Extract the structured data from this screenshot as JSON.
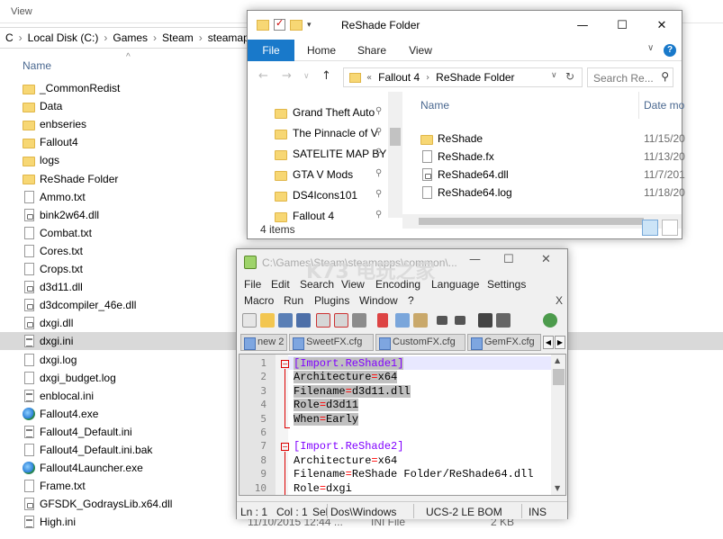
{
  "background_explorer": {
    "ribbon_tab": "View",
    "breadcrumb": [
      "C",
      "Local Disk (C:)",
      "Games",
      "Steam",
      "steamapps"
    ],
    "column_name": "Name",
    "rows": [
      {
        "name": "_CommonRedist",
        "type": "folder"
      },
      {
        "name": "Data",
        "type": "folder"
      },
      {
        "name": "enbseries",
        "type": "folder"
      },
      {
        "name": "Fallout4",
        "type": "folder"
      },
      {
        "name": "logs",
        "type": "folder"
      },
      {
        "name": "ReShade Folder",
        "type": "folder"
      },
      {
        "name": "Ammo.txt",
        "type": "file"
      },
      {
        "name": "bink2w64.dll",
        "type": "dll"
      },
      {
        "name": "Combat.txt",
        "type": "file"
      },
      {
        "name": "Cores.txt",
        "type": "file"
      },
      {
        "name": "Crops.txt",
        "type": "file"
      },
      {
        "name": "d3d11.dll",
        "type": "dll"
      },
      {
        "name": "d3dcompiler_46e.dll",
        "type": "dll"
      },
      {
        "name": "dxgi.dll",
        "type": "dll"
      },
      {
        "name": "dxgi.ini",
        "type": "ini",
        "selected": true
      },
      {
        "name": "dxgi.log",
        "type": "file"
      },
      {
        "name": "dxgi_budget.log",
        "type": "file"
      },
      {
        "name": "enblocal.ini",
        "type": "ini"
      },
      {
        "name": "Fallout4.exe",
        "type": "exe"
      },
      {
        "name": "Fallout4_Default.ini",
        "type": "ini"
      },
      {
        "name": "Fallout4_Default.ini.bak",
        "type": "file"
      },
      {
        "name": "Fallout4Launcher.exe",
        "type": "exe"
      },
      {
        "name": "Frame.txt",
        "type": "file"
      },
      {
        "name": "GFSDK_GodraysLib.x64.dll",
        "type": "dll"
      },
      {
        "name": "High.ini",
        "type": "ini"
      }
    ],
    "last_row_details": {
      "date": "11/10/2015 12:44 ...",
      "type": "INI File",
      "size": "2 KB"
    }
  },
  "explorer": {
    "title": "ReShade Folder",
    "tabs": [
      "File",
      "Home",
      "Share",
      "View"
    ],
    "address": {
      "prefix": "«",
      "parts": [
        "Fallout 4",
        "ReShade Folder"
      ]
    },
    "search_placeholder": "Search Re...",
    "nav_items": [
      {
        "label": "Grand Theft Auto"
      },
      {
        "label": "The Pinnacle of V"
      },
      {
        "label": "SATELITE MAP BY"
      },
      {
        "label": "GTA V Mods"
      },
      {
        "label": "DS4Icons101"
      },
      {
        "label": "Fallout 4"
      }
    ],
    "columns": {
      "name": "Name",
      "date": "Date mo"
    },
    "files": [
      {
        "name": "ReShade",
        "date": "11/15/20",
        "type": "folder"
      },
      {
        "name": "ReShade.fx",
        "date": "11/13/20",
        "type": "file"
      },
      {
        "name": "ReShade64.dll",
        "date": "11/7/201",
        "type": "dll"
      },
      {
        "name": "ReShade64.log",
        "date": "11/18/20",
        "type": "file"
      }
    ],
    "status": "4 items"
  },
  "notepad": {
    "title": "C:\\Games\\Steam\\steamapps\\common\\...",
    "menu_row1": [
      "File",
      "Edit",
      "Search",
      "View",
      "Encoding",
      "Language",
      "Settings"
    ],
    "menu_row2": [
      "Macro",
      "Run",
      "Plugins",
      "Window",
      "?"
    ],
    "close_x": "X",
    "tabs": [
      "new 2",
      "SweetFX.cfg",
      "CustomFX.cfg",
      "GemFX.cfg"
    ],
    "lines": [
      {
        "n": "1",
        "key": "[Import.ReShade1]",
        "section": true
      },
      {
        "n": "2",
        "key": "Architecture",
        "value": "x64"
      },
      {
        "n": "3",
        "key": "Filename",
        "value": "d3d11.dll"
      },
      {
        "n": "4",
        "key": "Role",
        "value": "d3d11"
      },
      {
        "n": "5",
        "key": "When",
        "value": "Early"
      },
      {
        "n": "6",
        "key": ""
      },
      {
        "n": "7",
        "key": "[Import.ReShade2]",
        "section": true
      },
      {
        "n": "8",
        "key": "Architecture",
        "value": "x64"
      },
      {
        "n": "9",
        "key": "Filename",
        "value": "ReShade Folder/ReShade64.dll"
      },
      {
        "n": "10",
        "key": "Role",
        "value": "dxgi"
      }
    ],
    "status": {
      "ln": "Ln : 1",
      "col": "Col : 1",
      "sel": "Sel",
      "eol": "Dos\\Windows",
      "encoding": "UCS-2 LE BOM",
      "mode": "INS"
    }
  },
  "watermark": "K73 电玩之家"
}
